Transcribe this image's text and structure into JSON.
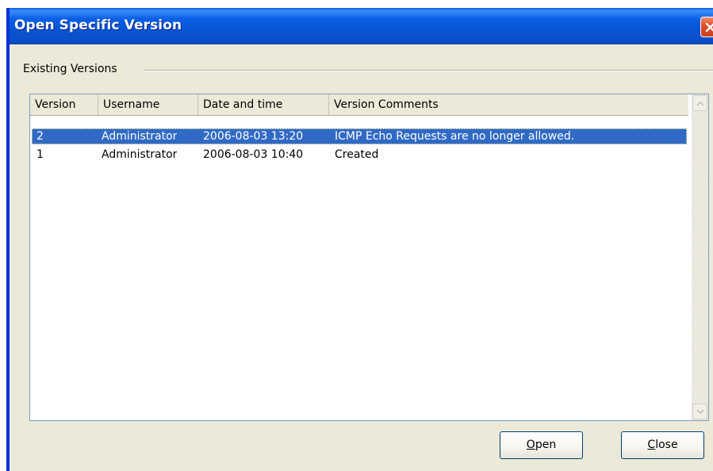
{
  "window": {
    "title": "Open Specific Version"
  },
  "icons": {
    "close": "close-icon",
    "scroll_up": "arrow-up-icon",
    "scroll_down": "arrow-down-icon"
  },
  "colors": {
    "titlebar": "#0a5fe6",
    "selection": "#316ac5",
    "close_button": "#e04a22",
    "dialog_bg": "#ece9d8"
  },
  "group": {
    "label": "Existing Versions"
  },
  "table": {
    "columns": [
      "Version",
      "Username",
      "Date and time",
      "Version Comments"
    ],
    "rows": [
      {
        "version": "2",
        "username": "Administrator",
        "datetime": "2006-08-03 13:20",
        "comment": "ICMP Echo Requests are no longer allowed.",
        "selected": true
      },
      {
        "version": "1",
        "username": "Administrator",
        "datetime": "2006-08-03 10:40",
        "comment": "Created",
        "selected": false
      }
    ]
  },
  "buttons": {
    "open_label": "Open",
    "open_accel": "O",
    "open_rest": "pen",
    "close_label": "Close",
    "close_accel": "C",
    "close_rest": "lose"
  }
}
